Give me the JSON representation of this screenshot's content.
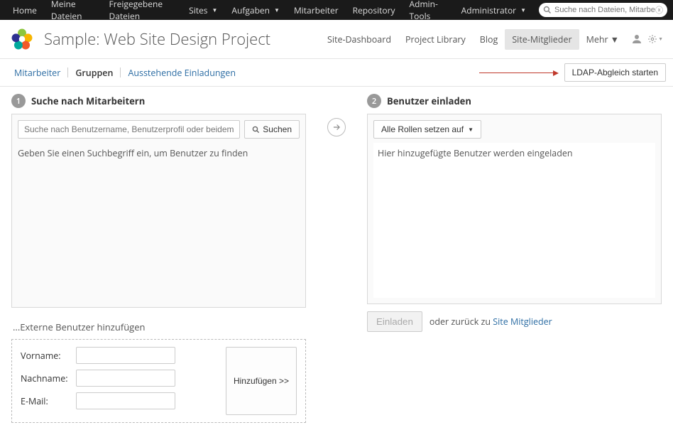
{
  "topnav": {
    "items": [
      {
        "label": "Home",
        "dropdown": false
      },
      {
        "label": "Meine Dateien",
        "dropdown": false
      },
      {
        "label": "Freigegebene Dateien",
        "dropdown": false
      },
      {
        "label": "Sites",
        "dropdown": true
      },
      {
        "label": "Aufgaben",
        "dropdown": true
      },
      {
        "label": "Mitarbeiter",
        "dropdown": false
      },
      {
        "label": "Repository",
        "dropdown": false
      },
      {
        "label": "Admin-Tools",
        "dropdown": false
      }
    ],
    "user": "Administrator",
    "search_placeholder": "Suche nach Dateien, Mitarbeit"
  },
  "site": {
    "title": "Sample: Web Site Design Project",
    "nav": [
      {
        "label": "Site-Dashboard",
        "active": false
      },
      {
        "label": "Project Library",
        "active": false
      },
      {
        "label": "Blog",
        "active": false
      },
      {
        "label": "Site-Mitglieder",
        "active": true
      }
    ],
    "more": "Mehr"
  },
  "subtabs": {
    "items": [
      {
        "label": "Mitarbeiter",
        "active": false
      },
      {
        "label": "Gruppen",
        "active": true
      },
      {
        "label": "Ausstehende Einladungen",
        "active": false
      }
    ],
    "ldap_button": "LDAP-Abgleich starten"
  },
  "left": {
    "step_num": "1",
    "step_title": "Suche nach Mitarbeitern",
    "search_placeholder": "Suche nach Benutzername, Benutzerprofil oder beidem",
    "search_button": "Suchen",
    "hint": "Geben Sie einen Suchbegriff ein, um Benutzer zu finden",
    "ext_title": "...Externe Benutzer hinzufügen",
    "form": {
      "vorname": "Vorname:",
      "nachname": "Nachname:",
      "email": "E-Mail:"
    },
    "add_button": "Hinzufügen >>"
  },
  "right": {
    "step_num": "2",
    "step_title": "Benutzer einladen",
    "role_button": "Alle Rollen setzen auf",
    "list_hint": "Hier hinzugefügte Benutzer werden eingeladen",
    "invite_button": "Einladen",
    "back_prefix": "oder zurück zu ",
    "back_link": "Site Mitglieder"
  }
}
